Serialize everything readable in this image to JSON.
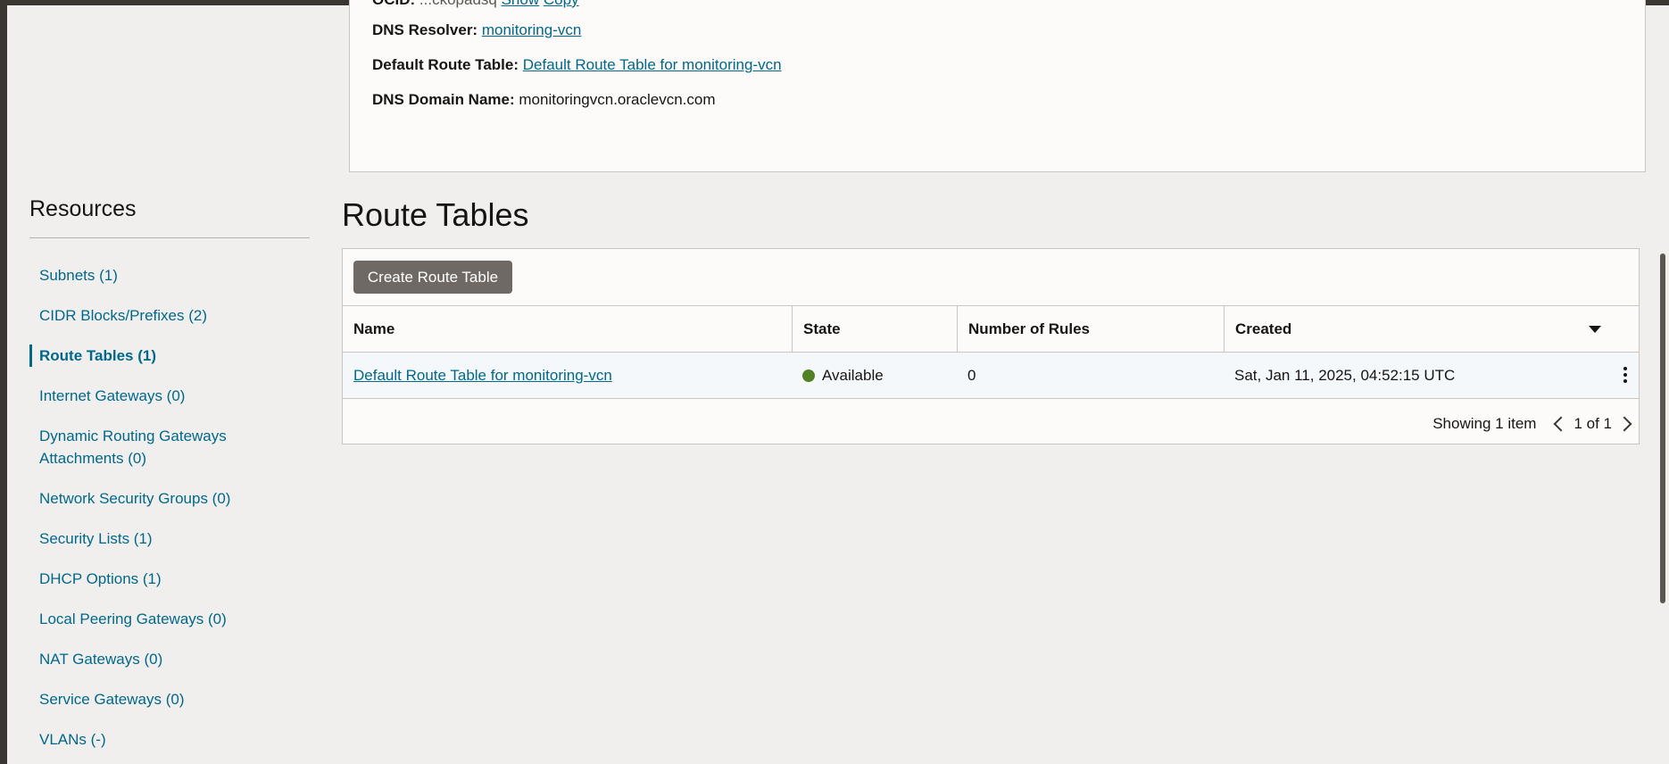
{
  "details": {
    "ocid_label": "OCID:",
    "ocid_value": "...ckopadsq",
    "ocid_show": "Show",
    "ocid_copy": "Copy",
    "dns_resolver_label": "DNS Resolver:",
    "dns_resolver_value": "monitoring-vcn",
    "default_route_table_label": "Default Route Table:",
    "default_route_table_value": "Default Route Table for monitoring-vcn",
    "dns_domain_label": "DNS Domain Name:",
    "dns_domain_value": "monitoringvcn.oraclevcn.com"
  },
  "resources": {
    "title": "Resources",
    "items": [
      {
        "label": "Subnets (1)"
      },
      {
        "label": "CIDR Blocks/Prefixes (2)"
      },
      {
        "label": "Route Tables (1)"
      },
      {
        "label": "Internet Gateways (0)"
      },
      {
        "label": "Dynamic Routing Gateways Attachments (0)"
      },
      {
        "label": "Network Security Groups (0)"
      },
      {
        "label": "Security Lists (1)"
      },
      {
        "label": "DHCP Options (1)"
      },
      {
        "label": "Local Peering Gateways (0)"
      },
      {
        "label": "NAT Gateways (0)"
      },
      {
        "label": "Service Gateways (0)"
      },
      {
        "label": "VLANs (-)"
      }
    ],
    "active_item": "Route Tables (1)"
  },
  "route_tables": {
    "title": "Route Tables",
    "create_button": "Create Route Table",
    "columns": [
      "Name",
      "State",
      "Number of Rules",
      "Created"
    ],
    "rows": [
      {
        "name": "Default Route Table for monitoring-vcn",
        "state": "Available",
        "rules": "0",
        "created": "Sat, Jan 11, 2025, 04:52:15 UTC"
      }
    ],
    "pager": {
      "showing": "Showing 1 item",
      "page": "1 of 1"
    }
  },
  "colors": {
    "link": "#00688c",
    "status_available": "#508223",
    "button_bg": "#6f6965"
  },
  "icons": [
    "sort-down-icon",
    "status-dot-icon",
    "kebab-menu-icon",
    "chevron-left-icon",
    "chevron-right-icon"
  ]
}
